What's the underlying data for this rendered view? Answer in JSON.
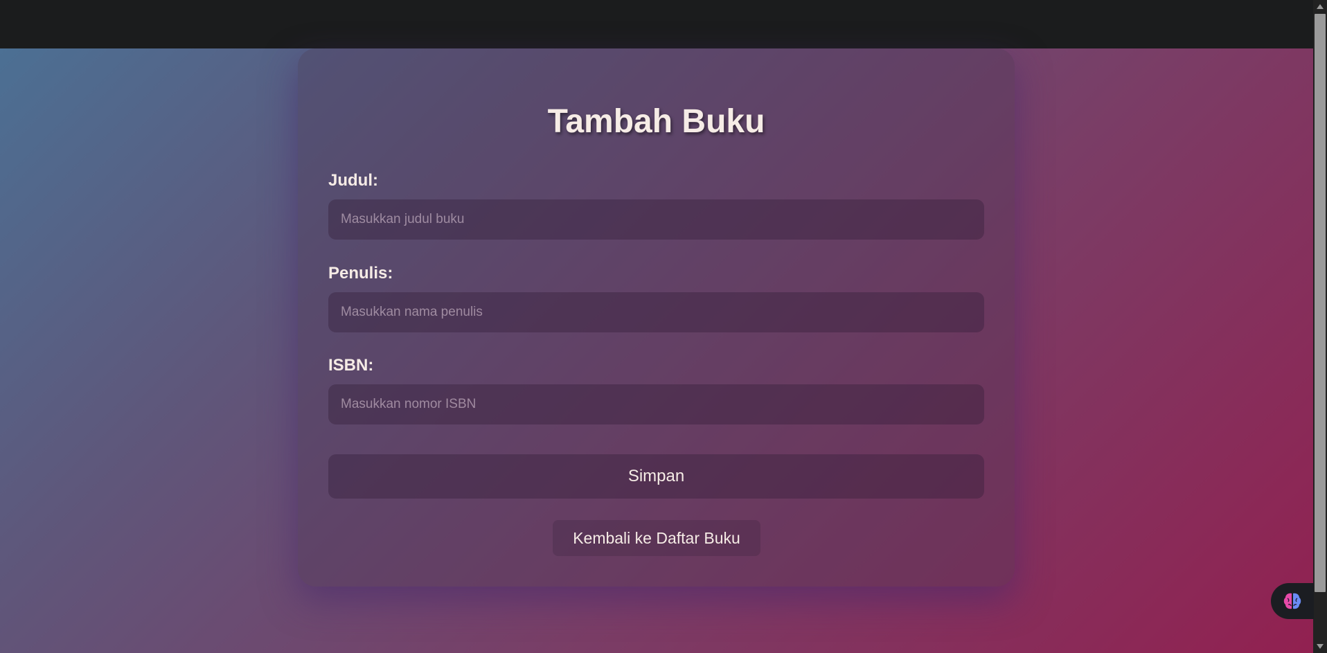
{
  "form": {
    "title": "Tambah Buku",
    "fields": [
      {
        "label": "Judul:",
        "placeholder": "Masukkan judul buku",
        "value": ""
      },
      {
        "label": "Penulis:",
        "placeholder": "Masukkan nama penulis",
        "value": ""
      },
      {
        "label": "ISBN:",
        "placeholder": "Masukkan nomor ISBN",
        "value": ""
      }
    ],
    "submit_label": "Simpan",
    "back_link_label": "Kembali ke Daftar Buku"
  },
  "widget": {
    "icon": "brain-icon"
  },
  "colors": {
    "gradient_start": "#4a7296",
    "gradient_mid": "#7a3d66",
    "gradient_end": "#922050",
    "text": "#f6ece6",
    "topbar": "#1b1c1d"
  }
}
